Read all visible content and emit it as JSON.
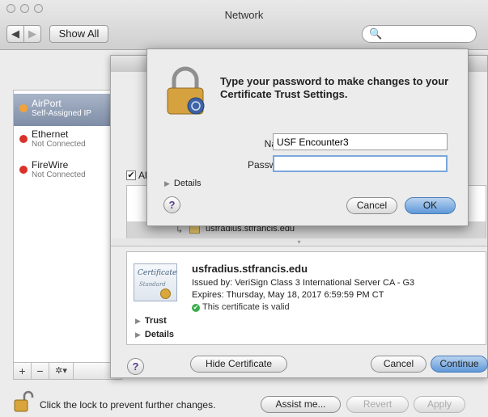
{
  "window": {
    "title": "Network",
    "nav_back": "◀",
    "nav_forward": "▶",
    "show_all": "Show All",
    "search_icon": "🔍"
  },
  "sidebar": {
    "services": [
      {
        "name": "AirPort",
        "status": "Self-Assigned IP",
        "dot_color": "#f2a23a"
      },
      {
        "name": "Ethernet",
        "status": "Not Connected",
        "dot_color": "#d9322b"
      },
      {
        "name": "FireWire",
        "status": "Not Connected",
        "dot_color": "#d9322b"
      }
    ],
    "add": "+",
    "remove": "−",
    "action": "✲▾"
  },
  "footer": {
    "lock_text": "Click the lock to prevent further changes.",
    "assist": "Assist me...",
    "revert": "Revert",
    "apply": "Apply"
  },
  "sheet": {
    "always_check": "✔",
    "always_label": "Al",
    "chain_selected": "usfradius.stfrancis.edu",
    "chain_arrow": "↳",
    "cert": {
      "badge_t1": "Certificate",
      "badge_t2": "Standard",
      "title": "usfradius.stfrancis.edu",
      "issued": "Issued by: VeriSign Class 3 International Server CA - G3",
      "expires": "Expires: Thursday, May 18, 2017 6:59:59 PM CT",
      "valid_icon": "✔",
      "valid": "This certificate is valid"
    },
    "trust": "Trust",
    "details": "Details",
    "help": "?",
    "hide_certificate": "Hide Certificate",
    "cancel": "Cancel",
    "continue": "Continue",
    "accent_color": "#5f98d8"
  },
  "dialog": {
    "message": "Type your password to make changes to your Certificate Trust Settings.",
    "name_label": "Name:",
    "name_value": "USF Encounter3",
    "password_label": "Password:",
    "password_value": "",
    "details": "Details",
    "help": "?",
    "cancel": "Cancel",
    "ok": "OK"
  }
}
